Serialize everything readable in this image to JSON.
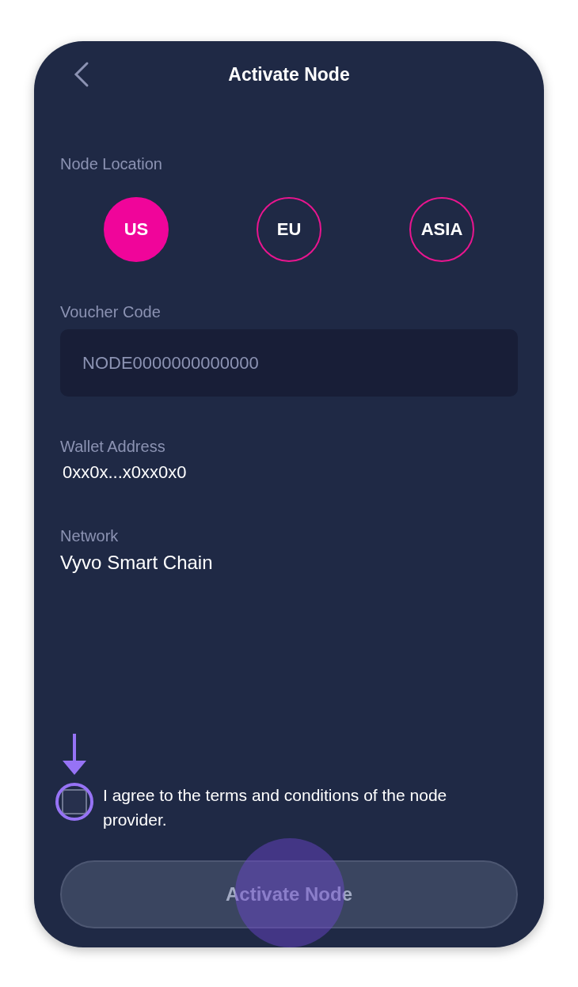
{
  "header": {
    "title": "Activate Node"
  },
  "node_location": {
    "label": "Node Location",
    "options": [
      {
        "label": "US",
        "selected": true
      },
      {
        "label": "EU",
        "selected": false
      },
      {
        "label": "ASIA",
        "selected": false
      }
    ]
  },
  "voucher_code": {
    "label": "Voucher Code",
    "placeholder": "NODE0000000000000"
  },
  "wallet_address": {
    "label": "Wallet Address",
    "value": "0xx0x...x0xx0x0"
  },
  "network": {
    "label": "Network",
    "value": "Vyvo Smart Chain"
  },
  "agreement": {
    "text": "I agree to the terms and conditions of the node provider.",
    "checked": false,
    "highlighted": true
  },
  "activate_button": {
    "label": "Activate Node",
    "disabled": true,
    "tapped": true
  }
}
